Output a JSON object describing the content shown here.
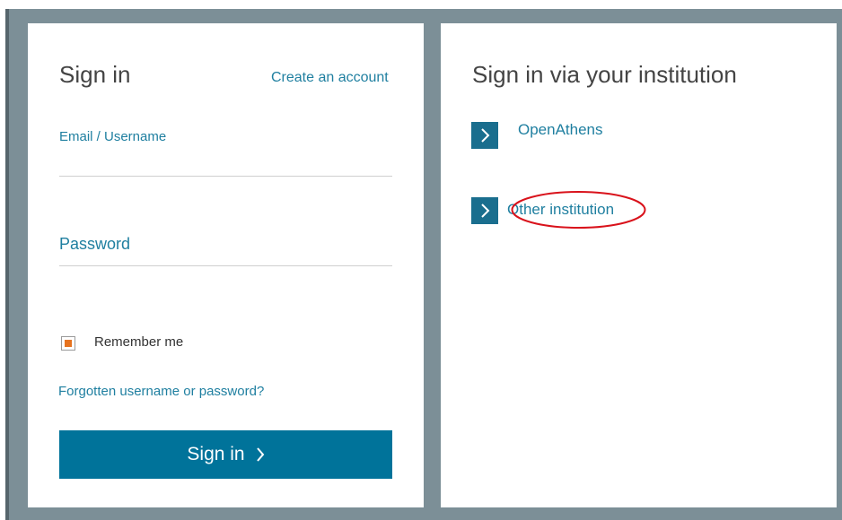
{
  "signin": {
    "heading": "Sign in",
    "create_account": "Create an account",
    "email_label": "Email / Username",
    "email_value": "",
    "password_label": "Password",
    "password_value": "",
    "remember_label": "Remember me",
    "remember_checked": true,
    "forgot_link": "Forgotten username or password?",
    "button_label": "Sign in"
  },
  "institution": {
    "heading": "Sign in via your institution",
    "options": [
      {
        "label": "OpenAthens"
      },
      {
        "label": "Other institution"
      }
    ]
  },
  "colors": {
    "accent": "#00739a",
    "link": "#1f7fa0",
    "checkbox_fill": "#e6731f",
    "annotation": "#d9121b"
  }
}
